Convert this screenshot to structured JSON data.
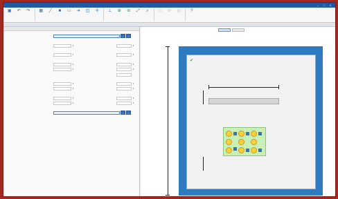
{
  "window": {
    "app_title": "",
    "doc_title": "",
    "controls": [
      "–",
      "□",
      "✕"
    ]
  },
  "ribbon": {
    "buttons": [
      {
        "label": "",
        "icon": "save-icon"
      },
      {
        "label": "",
        "icon": "undo-icon"
      },
      {
        "label": "",
        "icon": "redo-icon"
      },
      {
        "label": "",
        "icon": "grid-icon"
      },
      {
        "label": "",
        "icon": "line-icon"
      },
      {
        "label": "",
        "icon": "square-icon"
      },
      {
        "label": "",
        "icon": "rect-icon"
      },
      {
        "label": "",
        "icon": "arrow-icon"
      },
      {
        "label": "",
        "icon": "frame-icon"
      },
      {
        "label": "",
        "icon": "axis-icon"
      },
      {
        "label": "",
        "icon": "pin-icon"
      },
      {
        "label": "",
        "icon": "zoom-in-icon"
      },
      {
        "label": "",
        "icon": "zoom-out-icon"
      },
      {
        "label": "",
        "icon": "fit-icon"
      },
      {
        "label": "",
        "icon": "search-icon"
      },
      {
        "label": "",
        "icon": "lock-icon"
      },
      {
        "label": "",
        "icon": "settings-icon"
      },
      {
        "label": "",
        "icon": "grid2-icon"
      },
      {
        "label": "",
        "icon": "help-icon"
      }
    ]
  },
  "breadcrumb": "",
  "left_panel": {
    "header": "",
    "rows": [
      {
        "type": "field",
        "label": "",
        "value": "",
        "button": "…"
      },
      {
        "type": "section",
        "label": ""
      },
      {
        "type": "pair",
        "label": "",
        "value": "",
        "label2": "",
        "value2": ""
      },
      {
        "type": "section",
        "label": ""
      },
      {
        "type": "pair",
        "label": "",
        "value": "",
        "label2": "",
        "value2": ""
      },
      {
        "type": "section",
        "label": ""
      },
      {
        "type": "pair",
        "label": "",
        "value": "",
        "label2": "",
        "value2": ""
      },
      {
        "type": "pair",
        "label": "",
        "value": "",
        "label2": "",
        "value2": ""
      },
      {
        "type": "single",
        "label": "",
        "value": ""
      },
      {
        "type": "section",
        "label": ""
      },
      {
        "type": "pair",
        "label": "",
        "value": "",
        "label2": "",
        "value2": ""
      },
      {
        "type": "pair",
        "label": "",
        "value": "",
        "label2": "",
        "value2": ""
      },
      {
        "type": "section",
        "label": ""
      },
      {
        "type": "pair",
        "label": "",
        "value": "",
        "label2": "",
        "value2": ""
      },
      {
        "type": "pair",
        "label": "",
        "value": "",
        "label2": "",
        "value2": ""
      },
      {
        "type": "section",
        "label": ""
      },
      {
        "type": "field",
        "label": "",
        "value": "",
        "button": "…"
      }
    ]
  },
  "drawing": {
    "tabs": [
      "",
      ""
    ],
    "checkbox_label": "",
    "dim_total": "",
    "dim_width": "",
    "dim_top": "",
    "dim_bottom": ""
  }
}
